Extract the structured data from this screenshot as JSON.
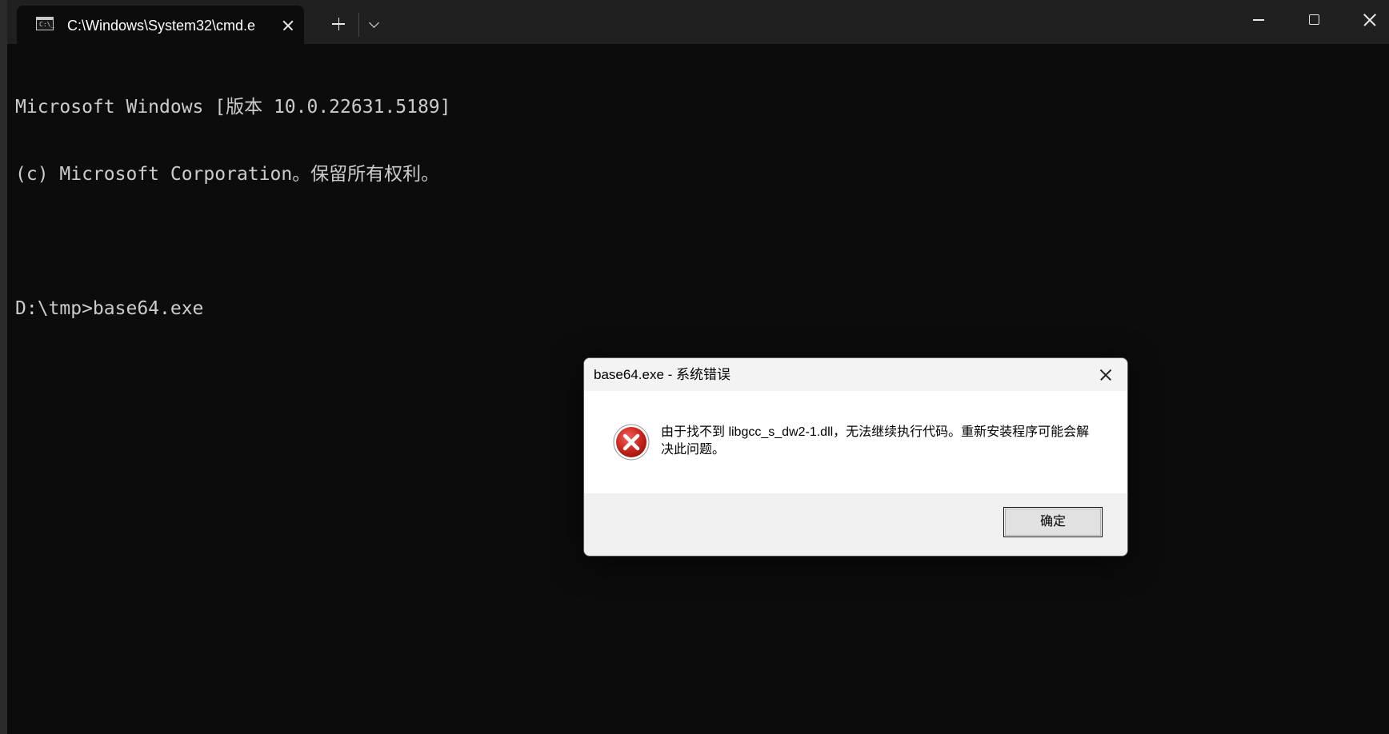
{
  "terminal": {
    "tab_title": "C:\\Windows\\System32\\cmd.e",
    "tab_icon": "console-icon",
    "tab_icon_text": "C:\\_",
    "lines": [
      "Microsoft Windows [版本 10.0.22631.5189]",
      "(c) Microsoft Corporation。保留所有权利。",
      "",
      "D:\\tmp>base64.exe"
    ],
    "background_color": "#0c0c0c",
    "text_color": "#cccccc"
  },
  "dialog": {
    "title": "base64.exe - 系统错误",
    "icon": "error-icon",
    "message": "由于找不到 libgcc_s_dw2-1.dll，无法继续执行代码。重新安装程序可能会解决此问题。",
    "ok_label": "确定",
    "error_color": "#c42b1c"
  }
}
